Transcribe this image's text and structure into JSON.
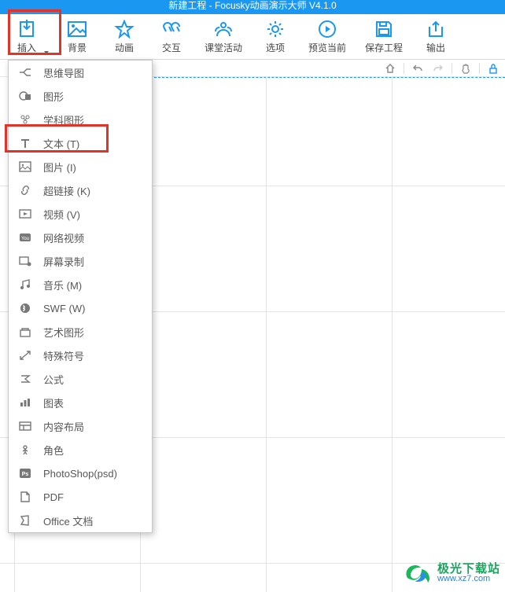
{
  "title": "新建工程 - Focusky动画演示大师 V4.1.0",
  "toolbar": {
    "insert": "插入",
    "background": "背景",
    "animation": "动画",
    "interaction": "交互",
    "class_activity": "课堂活动",
    "options": "选项",
    "preview": "预览当前",
    "save": "保存工程",
    "export": "输出"
  },
  "menu": {
    "mindmap": "思维导图",
    "shape": "图形",
    "subject_shape": "学科图形",
    "text": "文本 (T)",
    "image": "图片 (I)",
    "hyperlink": "超链接 (K)",
    "video": "视频 (V)",
    "webvideo": "网络视频",
    "screenrec": "屏幕录制",
    "music": "音乐 (M)",
    "swf": "SWF (W)",
    "artshape": "艺术图形",
    "specialchar": "特殊符号",
    "formula": "公式",
    "chart": "图表",
    "layout": "内容布局",
    "character": "角色",
    "photoshop": "PhotoShop(psd)",
    "pdf": "PDF",
    "office": "Office 文档"
  },
  "watermark": {
    "cn": "极光下载站",
    "url": "www.xz7.com"
  }
}
